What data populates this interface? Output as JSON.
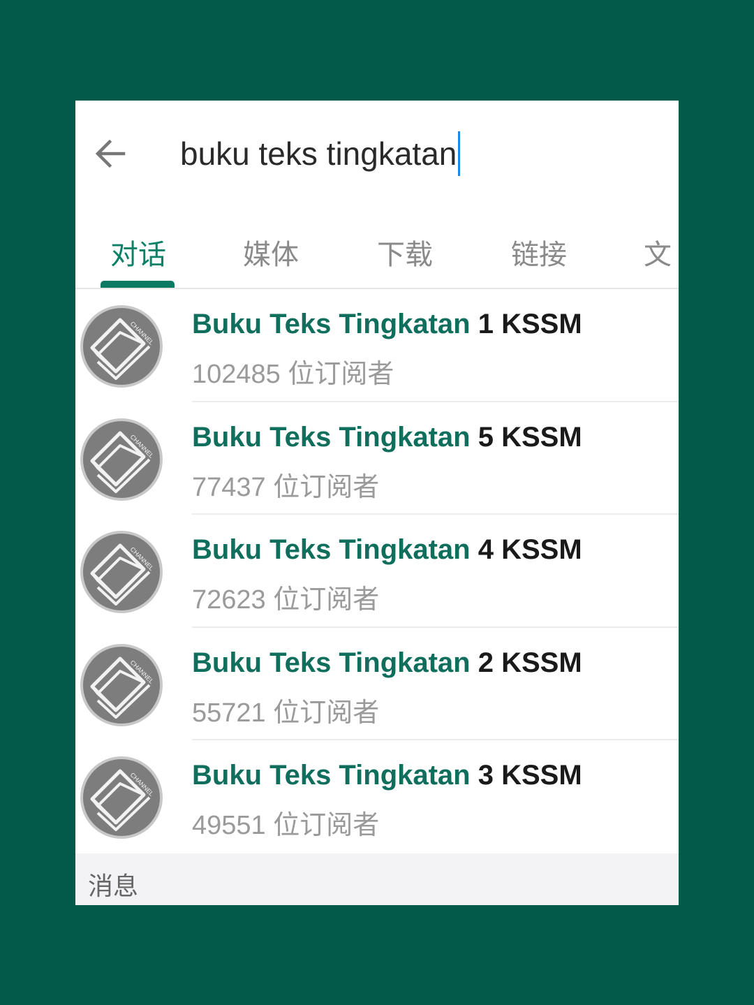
{
  "search": {
    "query": "buku teks tingkatan"
  },
  "tabs": [
    {
      "label": "对话",
      "active": true
    },
    {
      "label": "媒体",
      "active": false
    },
    {
      "label": "下载",
      "active": false
    },
    {
      "label": "链接",
      "active": false
    },
    {
      "label": "文",
      "active": false
    }
  ],
  "results": [
    {
      "title_match": "Buku Teks Tingkatan",
      "title_rest": " 1 KSSM",
      "subscribers": "102485 位订阅者"
    },
    {
      "title_match": "Buku Teks Tingkatan",
      "title_rest": " 5 KSSM",
      "subscribers": "77437 位订阅者"
    },
    {
      "title_match": "Buku Teks Tingkatan",
      "title_rest": " 4 KSSM",
      "subscribers": "72623 位订阅者"
    },
    {
      "title_match": "Buku Teks Tingkatan",
      "title_rest": " 2 KSSM",
      "subscribers": "55721 位订阅者"
    },
    {
      "title_match": "Buku Teks Tingkatan",
      "title_rest": " 3 KSSM",
      "subscribers": "49551 位订阅者"
    }
  ],
  "section": {
    "label": "消息"
  },
  "avatar_badge": "CHANNEL",
  "colors": {
    "background": "#03594a",
    "accent": "#0b7a62",
    "match_text": "#0f6e5c",
    "caret": "#1e88e5"
  }
}
